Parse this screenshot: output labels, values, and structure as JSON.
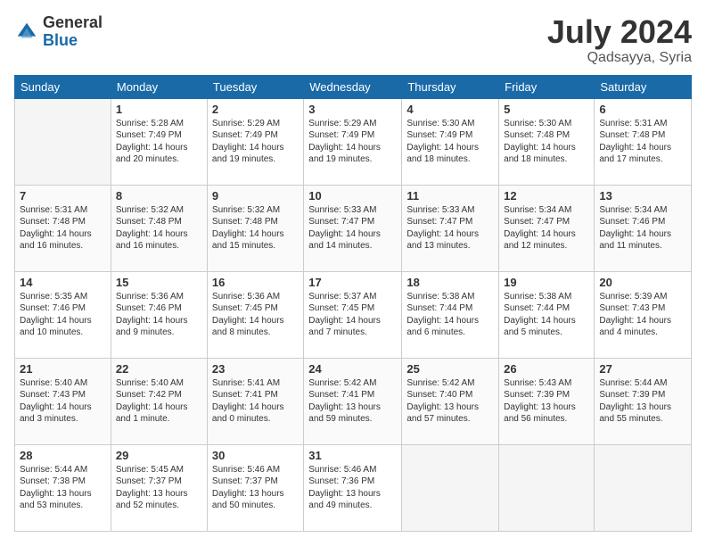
{
  "header": {
    "logo_general": "General",
    "logo_blue": "Blue",
    "month_year": "July 2024",
    "location": "Qadsayya, Syria"
  },
  "weekdays": [
    "Sunday",
    "Monday",
    "Tuesday",
    "Wednesday",
    "Thursday",
    "Friday",
    "Saturday"
  ],
  "weeks": [
    [
      {
        "day": "",
        "sunrise": "",
        "sunset": "",
        "daylight": ""
      },
      {
        "day": "1",
        "sunrise": "Sunrise: 5:28 AM",
        "sunset": "Sunset: 7:49 PM",
        "daylight": "Daylight: 14 hours and 20 minutes."
      },
      {
        "day": "2",
        "sunrise": "Sunrise: 5:29 AM",
        "sunset": "Sunset: 7:49 PM",
        "daylight": "Daylight: 14 hours and 19 minutes."
      },
      {
        "day": "3",
        "sunrise": "Sunrise: 5:29 AM",
        "sunset": "Sunset: 7:49 PM",
        "daylight": "Daylight: 14 hours and 19 minutes."
      },
      {
        "day": "4",
        "sunrise": "Sunrise: 5:30 AM",
        "sunset": "Sunset: 7:49 PM",
        "daylight": "Daylight: 14 hours and 18 minutes."
      },
      {
        "day": "5",
        "sunrise": "Sunrise: 5:30 AM",
        "sunset": "Sunset: 7:48 PM",
        "daylight": "Daylight: 14 hours and 18 minutes."
      },
      {
        "day": "6",
        "sunrise": "Sunrise: 5:31 AM",
        "sunset": "Sunset: 7:48 PM",
        "daylight": "Daylight: 14 hours and 17 minutes."
      }
    ],
    [
      {
        "day": "7",
        "sunrise": "Sunrise: 5:31 AM",
        "sunset": "Sunset: 7:48 PM",
        "daylight": "Daylight: 14 hours and 16 minutes."
      },
      {
        "day": "8",
        "sunrise": "Sunrise: 5:32 AM",
        "sunset": "Sunset: 7:48 PM",
        "daylight": "Daylight: 14 hours and 16 minutes."
      },
      {
        "day": "9",
        "sunrise": "Sunrise: 5:32 AM",
        "sunset": "Sunset: 7:48 PM",
        "daylight": "Daylight: 14 hours and 15 minutes."
      },
      {
        "day": "10",
        "sunrise": "Sunrise: 5:33 AM",
        "sunset": "Sunset: 7:47 PM",
        "daylight": "Daylight: 14 hours and 14 minutes."
      },
      {
        "day": "11",
        "sunrise": "Sunrise: 5:33 AM",
        "sunset": "Sunset: 7:47 PM",
        "daylight": "Daylight: 14 hours and 13 minutes."
      },
      {
        "day": "12",
        "sunrise": "Sunrise: 5:34 AM",
        "sunset": "Sunset: 7:47 PM",
        "daylight": "Daylight: 14 hours and 12 minutes."
      },
      {
        "day": "13",
        "sunrise": "Sunrise: 5:34 AM",
        "sunset": "Sunset: 7:46 PM",
        "daylight": "Daylight: 14 hours and 11 minutes."
      }
    ],
    [
      {
        "day": "14",
        "sunrise": "Sunrise: 5:35 AM",
        "sunset": "Sunset: 7:46 PM",
        "daylight": "Daylight: 14 hours and 10 minutes."
      },
      {
        "day": "15",
        "sunrise": "Sunrise: 5:36 AM",
        "sunset": "Sunset: 7:46 PM",
        "daylight": "Daylight: 14 hours and 9 minutes."
      },
      {
        "day": "16",
        "sunrise": "Sunrise: 5:36 AM",
        "sunset": "Sunset: 7:45 PM",
        "daylight": "Daylight: 14 hours and 8 minutes."
      },
      {
        "day": "17",
        "sunrise": "Sunrise: 5:37 AM",
        "sunset": "Sunset: 7:45 PM",
        "daylight": "Daylight: 14 hours and 7 minutes."
      },
      {
        "day": "18",
        "sunrise": "Sunrise: 5:38 AM",
        "sunset": "Sunset: 7:44 PM",
        "daylight": "Daylight: 14 hours and 6 minutes."
      },
      {
        "day": "19",
        "sunrise": "Sunrise: 5:38 AM",
        "sunset": "Sunset: 7:44 PM",
        "daylight": "Daylight: 14 hours and 5 minutes."
      },
      {
        "day": "20",
        "sunrise": "Sunrise: 5:39 AM",
        "sunset": "Sunset: 7:43 PM",
        "daylight": "Daylight: 14 hours and 4 minutes."
      }
    ],
    [
      {
        "day": "21",
        "sunrise": "Sunrise: 5:40 AM",
        "sunset": "Sunset: 7:43 PM",
        "daylight": "Daylight: 14 hours and 3 minutes."
      },
      {
        "day": "22",
        "sunrise": "Sunrise: 5:40 AM",
        "sunset": "Sunset: 7:42 PM",
        "daylight": "Daylight: 14 hours and 1 minute."
      },
      {
        "day": "23",
        "sunrise": "Sunrise: 5:41 AM",
        "sunset": "Sunset: 7:41 PM",
        "daylight": "Daylight: 14 hours and 0 minutes."
      },
      {
        "day": "24",
        "sunrise": "Sunrise: 5:42 AM",
        "sunset": "Sunset: 7:41 PM",
        "daylight": "Daylight: 13 hours and 59 minutes."
      },
      {
        "day": "25",
        "sunrise": "Sunrise: 5:42 AM",
        "sunset": "Sunset: 7:40 PM",
        "daylight": "Daylight: 13 hours and 57 minutes."
      },
      {
        "day": "26",
        "sunrise": "Sunrise: 5:43 AM",
        "sunset": "Sunset: 7:39 PM",
        "daylight": "Daylight: 13 hours and 56 minutes."
      },
      {
        "day": "27",
        "sunrise": "Sunrise: 5:44 AM",
        "sunset": "Sunset: 7:39 PM",
        "daylight": "Daylight: 13 hours and 55 minutes."
      }
    ],
    [
      {
        "day": "28",
        "sunrise": "Sunrise: 5:44 AM",
        "sunset": "Sunset: 7:38 PM",
        "daylight": "Daylight: 13 hours and 53 minutes."
      },
      {
        "day": "29",
        "sunrise": "Sunrise: 5:45 AM",
        "sunset": "Sunset: 7:37 PM",
        "daylight": "Daylight: 13 hours and 52 minutes."
      },
      {
        "day": "30",
        "sunrise": "Sunrise: 5:46 AM",
        "sunset": "Sunset: 7:37 PM",
        "daylight": "Daylight: 13 hours and 50 minutes."
      },
      {
        "day": "31",
        "sunrise": "Sunrise: 5:46 AM",
        "sunset": "Sunset: 7:36 PM",
        "daylight": "Daylight: 13 hours and 49 minutes."
      },
      {
        "day": "",
        "sunrise": "",
        "sunset": "",
        "daylight": ""
      },
      {
        "day": "",
        "sunrise": "",
        "sunset": "",
        "daylight": ""
      },
      {
        "day": "",
        "sunrise": "",
        "sunset": "",
        "daylight": ""
      }
    ]
  ]
}
